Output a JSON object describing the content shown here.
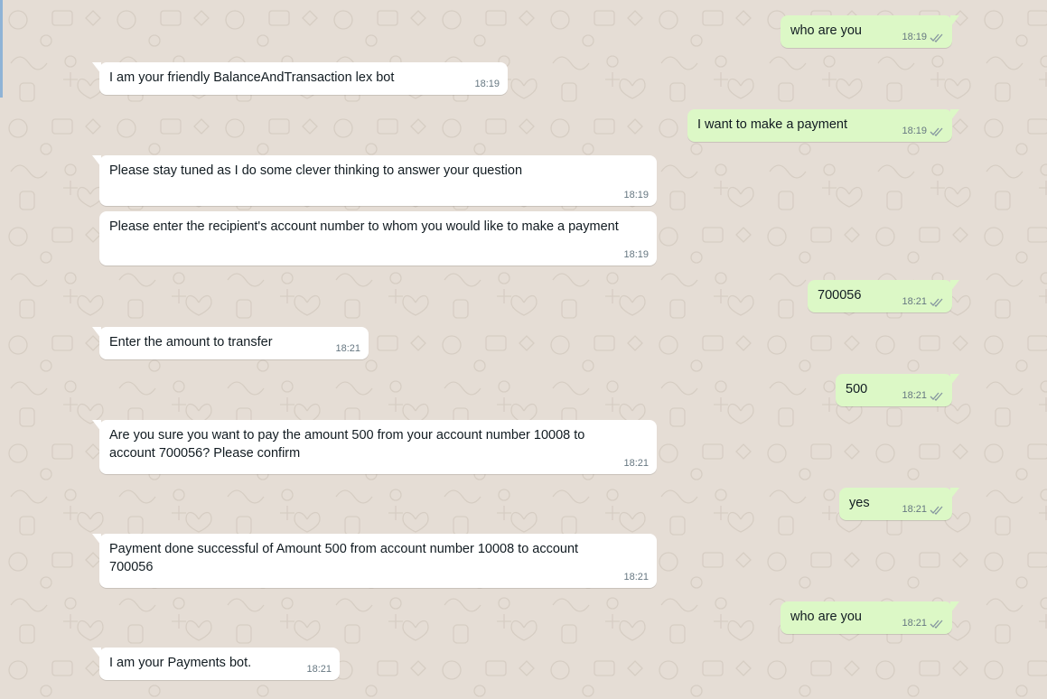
{
  "colors": {
    "background": "#e5ddd5",
    "incoming_bubble": "#ffffff",
    "outgoing_bubble": "#dcf8c6",
    "timestamp": "#667781",
    "tick": "#8696a0"
  },
  "icons": {
    "delivered": "double-check-icon"
  },
  "messages": [
    {
      "direction": "out",
      "text": "who are you",
      "time": "18:19",
      "status": "delivered"
    },
    {
      "direction": "in",
      "text": "I am your friendly BalanceAndTransaction lex bot",
      "time": "18:19"
    },
    {
      "direction": "out",
      "text": "I want to make a payment",
      "time": "18:19",
      "status": "delivered"
    },
    {
      "direction": "in",
      "text": "Please stay tuned as I do some clever thinking to answer your question",
      "time": "18:19"
    },
    {
      "direction": "in",
      "text": "Please enter the recipient's account number to whom you would like to make a payment",
      "time": "18:19"
    },
    {
      "direction": "out",
      "text": "700056",
      "time": "18:21",
      "status": "delivered"
    },
    {
      "direction": "in",
      "text": "Enter the amount to transfer",
      "time": "18:21"
    },
    {
      "direction": "out",
      "text": "500",
      "time": "18:21",
      "status": "delivered"
    },
    {
      "direction": "in",
      "text": "Are you sure you want to pay the amount 500 from your account number 10008 to account 700056? Please confirm",
      "time": "18:21"
    },
    {
      "direction": "out",
      "text": "yes",
      "time": "18:21",
      "status": "delivered"
    },
    {
      "direction": "in",
      "text": "Payment done successful of Amount 500 from account number 10008 to account 700056",
      "time": "18:21"
    },
    {
      "direction": "out",
      "text": "who are you",
      "time": "18:21",
      "status": "delivered"
    },
    {
      "direction": "in",
      "text": "I am your Payments bot.",
      "time": "18:21"
    }
  ]
}
